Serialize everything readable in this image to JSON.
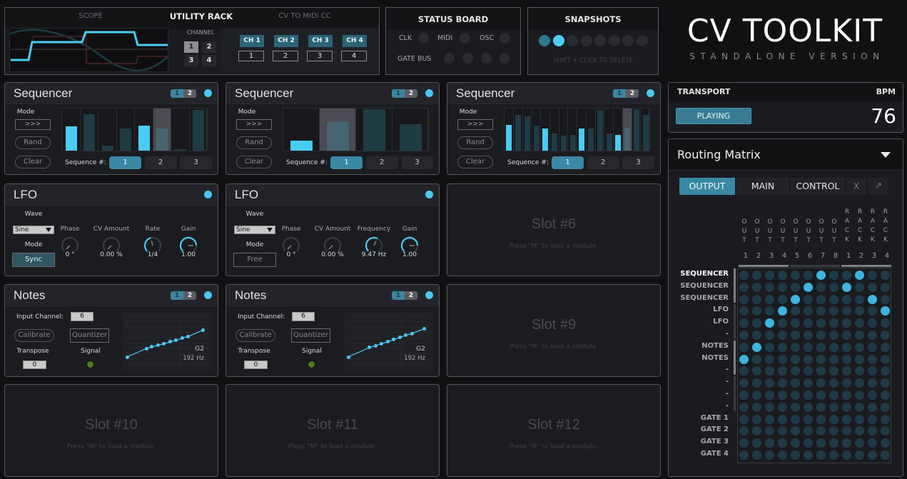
{
  "utility_rack": {
    "tabs": [
      "SCOPE",
      "UTILITY RACK",
      "CV TO MIDI CC"
    ],
    "active_tab": "UTILITY RACK",
    "channel_label": "CHANNEL",
    "channels": [
      "1",
      "2",
      "3",
      "4"
    ],
    "selected_channel": "1",
    "cc_channels": [
      {
        "label": "CH 1",
        "value": "1"
      },
      {
        "label": "CH 2",
        "value": "2"
      },
      {
        "label": "CH 3",
        "value": "3"
      },
      {
        "label": "CH 4",
        "value": "4"
      }
    ]
  },
  "status_board": {
    "title": "STATUS BOARD",
    "indicators": [
      "CLK",
      "MIDI",
      "OSC"
    ],
    "gate_bus_label": "GATE BUS"
  },
  "snapshots": {
    "title": "SNAPSHOTS",
    "hint": "SHIFT + CLICK TO DELETE",
    "count": 8,
    "states": [
      "saved",
      "active",
      "empty",
      "empty",
      "empty",
      "empty",
      "empty",
      "empty"
    ]
  },
  "brand": {
    "title": "CV TOOLKIT",
    "subtitle": "STANDALONE VERSION"
  },
  "transport": {
    "title": "TRANSPORT",
    "bpm_label": "BPM",
    "bpm": "76",
    "state_label": "PLAYING"
  },
  "colors": {
    "accent": "#49c9f2",
    "accent_dark": "#3a88a3",
    "bg": "#111012",
    "panel": "#1b1c20"
  },
  "sequencers": [
    {
      "title": "Sequencer",
      "page": [
        "1",
        "2"
      ],
      "mode_label": "Mode",
      "mode_value": ">>>",
      "rand_label": "Rand",
      "clear_label": "Clear",
      "seq_label": "Sequence #:",
      "sequences": [
        "1",
        "2",
        "3"
      ],
      "selected_sequence": "1",
      "steps": [
        0.57,
        0.87,
        0.12,
        0.52,
        0.59,
        0.52,
        0.03,
        0.96
      ],
      "active": [
        0,
        4
      ],
      "current_step": 5
    },
    {
      "title": "Sequencer",
      "page": [
        "1",
        "2"
      ],
      "mode_label": "Mode",
      "mode_value": ">>>",
      "rand_label": "Rand",
      "clear_label": "Clear",
      "seq_label": "Sequence #:",
      "sequences": [
        "1",
        "2",
        "3"
      ],
      "selected_sequence": "1",
      "steps": [
        0.23,
        0.68,
        0.98,
        0.62
      ],
      "active": [
        0
      ],
      "current_step": 1
    },
    {
      "title": "Sequencer",
      "page": [
        "1",
        "2"
      ],
      "mode_label": "Mode",
      "mode_value": ">>>",
      "rand_label": "Rand",
      "clear_label": "Clear",
      "seq_label": "Sequence #:",
      "sequences": [
        "1",
        "2",
        "3"
      ],
      "selected_sequence": "1",
      "steps": [
        0.61,
        0.85,
        0.81,
        0.59,
        0.53,
        0.41,
        0.36,
        0.38,
        0.53,
        0.52,
        0.97,
        0.41,
        0.37,
        0.55,
        0.98,
        0.84
      ],
      "active": [
        0,
        4,
        8,
        12
      ],
      "current_step": 13
    }
  ],
  "lfos": [
    {
      "title": "LFO",
      "wave_label": "Wave",
      "wave_value": "Sine",
      "mode_label": "Mode",
      "mode_value": "Sync",
      "mode_on": true,
      "knobs": [
        {
          "label": "Phase",
          "value": "0 °",
          "level": 0.0
        },
        {
          "label": "CV Amount",
          "value": "0.00 %",
          "level": 0.0
        },
        {
          "label": "Rate",
          "value": "1/4",
          "level": 0.45
        },
        {
          "label": "Gain",
          "value": "1.00",
          "level": 0.83
        }
      ]
    },
    {
      "title": "LFO",
      "wave_label": "Wave",
      "wave_value": "Sine",
      "mode_label": "Mode",
      "mode_value": "Free",
      "mode_on": false,
      "knobs": [
        {
          "label": "Phase",
          "value": "0 °",
          "level": 0.0
        },
        {
          "label": "CV Amount",
          "value": "0.00 %",
          "level": 0.0
        },
        {
          "label": "Frequency",
          "value": "9.47 Hz",
          "level": 0.6
        },
        {
          "label": "Gain",
          "value": "1.00",
          "level": 0.83
        }
      ]
    }
  ],
  "notes": [
    {
      "title": "Notes",
      "page": [
        "1",
        "2"
      ],
      "input_channel_label": "Input Channel:",
      "input_channel": "6",
      "calibrate_label": "Calibrate",
      "quantizer_label": "Quantizer",
      "transpose_label": "Transpose",
      "transpose": "0",
      "signal_label": "Signal",
      "note": "G2",
      "freq": "192 Hz",
      "curve": [
        [
          0,
          0
        ],
        [
          0.26,
          0.27
        ],
        [
          0.33,
          0.32
        ],
        [
          0.41,
          0.37
        ],
        [
          0.49,
          0.42
        ],
        [
          0.57,
          0.48
        ],
        [
          0.65,
          0.53
        ],
        [
          0.73,
          0.6
        ],
        [
          0.81,
          0.65
        ],
        [
          1,
          0.85
        ]
      ]
    },
    {
      "title": "Notes",
      "page": [
        "1",
        "2"
      ],
      "input_channel_label": "Input Channel:",
      "input_channel": "6",
      "calibrate_label": "Calibrate",
      "quantizer_label": "Quantizer",
      "transpose_label": "Transpose",
      "transpose": "0",
      "signal_label": "Signal",
      "note": "G2",
      "freq": "192 Hz",
      "curve": [
        [
          0,
          0
        ],
        [
          0.28,
          0.3
        ],
        [
          0.36,
          0.36
        ],
        [
          0.44,
          0.42
        ],
        [
          0.52,
          0.48
        ],
        [
          0.6,
          0.55
        ],
        [
          0.68,
          0.62
        ],
        [
          0.76,
          0.69
        ],
        [
          0.84,
          0.75
        ],
        [
          1,
          0.89
        ]
      ]
    }
  ],
  "slots": [
    {
      "title": "Slot #6",
      "hint": "Press \"M\" to load a module."
    },
    {
      "title": "Slot #9",
      "hint": "Press \"M\" to load a module."
    },
    {
      "title": "Slot #10",
      "hint": "Press \"M\" to load a module."
    },
    {
      "title": "Slot #11",
      "hint": "Press \"M\" to load a module."
    },
    {
      "title": "Slot #12",
      "hint": "Press \"M\" to load a module."
    }
  ],
  "routing": {
    "title": "Routing Matrix",
    "tabs": [
      "OUTPUT",
      "MAIN",
      "CONTROL"
    ],
    "active_tab": "OUTPUT",
    "close_label": "X",
    "expand_label": "↗",
    "columns": [
      {
        "name": "OUT",
        "num": "1"
      },
      {
        "name": "OUT",
        "num": "2"
      },
      {
        "name": "OUT",
        "num": "3"
      },
      {
        "name": "OUT",
        "num": "4"
      },
      {
        "name": "OUT",
        "num": "5"
      },
      {
        "name": "OUT",
        "num": "6"
      },
      {
        "name": "OUT",
        "num": "7"
      },
      {
        "name": "OUT",
        "num": "8"
      },
      {
        "name": "RACK",
        "num": "1"
      },
      {
        "name": "RACK",
        "num": "2"
      },
      {
        "name": "RACK",
        "num": "3"
      },
      {
        "name": "RACK",
        "num": "4"
      }
    ],
    "rows": [
      "SEQUENCER",
      "SEQUENCER",
      "SEQUENCER",
      "LFO",
      "LFO",
      "-",
      "NOTES",
      "NOTES",
      "-",
      "-",
      "-",
      "-",
      "GATE 1",
      "GATE 2",
      "GATE 3",
      "GATE 4"
    ],
    "highlight_row": 0,
    "connections": [
      [
        0,
        6
      ],
      [
        0,
        9
      ],
      [
        1,
        5
      ],
      [
        1,
        8
      ],
      [
        2,
        4
      ],
      [
        2,
        10
      ],
      [
        3,
        3
      ],
      [
        3,
        11
      ],
      [
        4,
        2
      ],
      [
        6,
        1
      ],
      [
        7,
        0
      ]
    ]
  }
}
